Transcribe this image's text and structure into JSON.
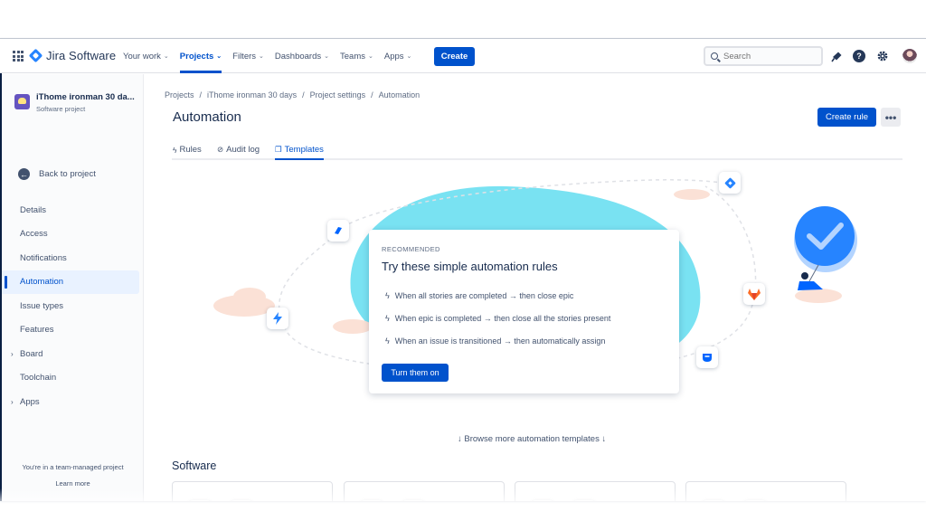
{
  "topnav": {
    "logo_text": "Jira Software",
    "items": [
      {
        "label": "Your work",
        "chev": "⌄"
      },
      {
        "label": "Projects",
        "chev": "⌄"
      },
      {
        "label": "Filters",
        "chev": "⌄"
      },
      {
        "label": "Dashboards",
        "chev": "⌄"
      },
      {
        "label": "Teams",
        "chev": "⌄"
      },
      {
        "label": "Apps",
        "chev": "⌄"
      }
    ],
    "active_item": "Projects",
    "create_label": "Create",
    "search_placeholder": "Search",
    "help_glyph": "?",
    "accent_color": "#0052cc"
  },
  "sidebar": {
    "project_name": "iThome ironman 30 da...",
    "project_type": "Software project",
    "back_label": "Back to project",
    "items": [
      {
        "label": "Details"
      },
      {
        "label": "Access"
      },
      {
        "label": "Notifications"
      },
      {
        "label": "Automation"
      },
      {
        "label": "Issue types"
      },
      {
        "label": "Features"
      },
      {
        "label": "Board",
        "caret": "›"
      },
      {
        "label": "Toolchain"
      },
      {
        "label": "Apps",
        "caret": "›"
      }
    ],
    "active_item": "Automation",
    "footer_text": "You're in a team-managed project",
    "footer_link": "Learn more"
  },
  "main": {
    "breadcrumbs": [
      "Projects",
      "iThome ironman 30 days",
      "Project settings",
      "Automation"
    ],
    "breadcrumb_sep": "/",
    "title": "Automation",
    "create_rule_label": "Create rule",
    "more_label": "•••",
    "tabs": [
      {
        "label": "Rules",
        "icon": "ϟ"
      },
      {
        "label": "Audit log",
        "icon": "⊘"
      },
      {
        "label": "Templates",
        "icon": "❐"
      }
    ],
    "active_tab": "Templates"
  },
  "recommend": {
    "label": "RECOMMENDED",
    "title": "Try these simple automation rules",
    "rules": [
      "When all stories are completed → then close epic",
      "When epic is completed → then close all the stories present",
      "When an issue is transitioned → then automatically assign"
    ],
    "button_label": "Turn them on"
  },
  "browse_label": "↓ Browse more automation templates ↓",
  "section_title": "Software",
  "template_cards": [
    {
      "from_icon": "jira-icon",
      "to_icon": "jira-icon"
    },
    {
      "from_icon": "jira-icon",
      "to_icon": "confluence-cross-icon"
    },
    {
      "from_icon": "jira-icon",
      "to_icon": "confluence-cross-icon"
    },
    {
      "from_icon": "jira-icon",
      "to_icon": "slack-icon"
    }
  ],
  "arrow_glyph": "→",
  "colors": {
    "blob": "#79e2f2",
    "primary": "#0052cc",
    "cloud": "#fbe1d6",
    "gitlab": "#fc6d26"
  }
}
